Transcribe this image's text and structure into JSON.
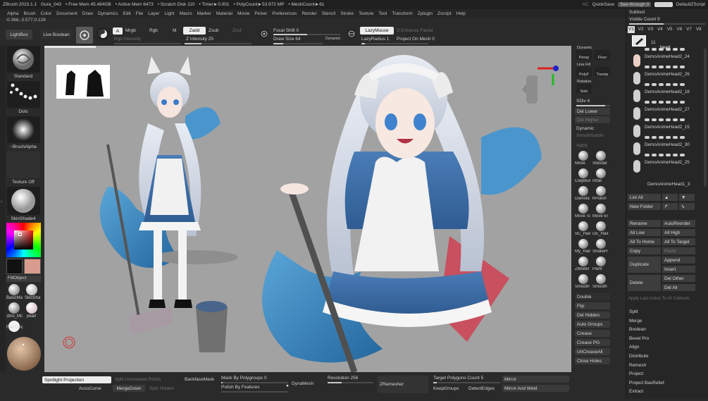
{
  "titlebar": {
    "app": "ZBrush 2023.1.1",
    "document": "Gura_043",
    "free_mem": "• Free Mem 45.484GB",
    "active_mem": "• Active Mem 6473",
    "scratch_disk": "• Scratch Disk 110",
    "timer": "• Timer►0.001",
    "poly_count": "• PolyCount►53.972 MP",
    "mesh_count": "• MeshCount►61",
    "ac": "AC",
    "quicksave": "QuickSave",
    "see_through": "See-through  0",
    "menus": "Menus",
    "default_script": "DefaultZScript"
  },
  "menubar": [
    "Alpha",
    "Brush",
    "Color",
    "Document",
    "Draw",
    "Dynamics",
    "Edit",
    "File",
    "Layer",
    "Light",
    "Macro",
    "Marker",
    "Material",
    "Movie",
    "Picker",
    "Preferences",
    "Render",
    "Stencil",
    "Stroke",
    "Texture",
    "Tool",
    "Transform",
    "Zplugin",
    "Zscript",
    "Help"
  ],
  "coords": "-0.366,-3.577,0.128",
  "topshelf": {
    "lightbox": "LightBox",
    "live_boolean": "Live Boolean",
    "a_btn": "A",
    "mrgb": "Mrgb",
    "rgb": "Rgb",
    "m": "M",
    "zadd": "Zadd",
    "zsub": "Zsub",
    "zcut": "Zcut",
    "rgb_intensity": "Rgb Intensity",
    "z_intensity": "Z Intensity 25",
    "focal_shift": "Focal Shift 0",
    "draw_size": "Draw Size 64",
    "dynamic": "Dynamic",
    "lazymouse": "LazyMouse",
    "lazyradius": "LazyRadius 1",
    "enhance_factor": "S Enhance Factor",
    "project_on_mesh": "Project On Mesh 0"
  },
  "leftpanel": {
    "standard": "Standard",
    "dots": "Dots",
    "brush_alpha": "~BrushAlpha",
    "texture_off": "Texture Off",
    "skin_shade": "SkinShade4",
    "fill_object": "FillObject",
    "mat1": "BasicMa",
    "mat2": "SkinSha",
    "mat3": "zbro_Mc",
    "mat4": "pearl",
    "mat5": "Flat Colc"
  },
  "rightshelf": {
    "dynamic_persp": "Dynamic",
    "persp": "Persp",
    "floor": "Floor",
    "line_fill": "Line Fill",
    "polyf": "PolyF",
    "transp": "Transp",
    "rotation": "Rotation",
    "solo": "Solo",
    "sdiv": "SDiv 4",
    "del_lower": "Del Lower",
    "del_higher": "Del Higher",
    "dynamic2": "Dynamic",
    "smooth_subdiv": "SmoothSubdiv",
    "apply": "Apply",
    "brushes": [
      [
        "Move",
        "Standar"
      ],
      [
        "ClayBuil",
        "Inflat"
      ],
      [
        "Damsta",
        "hPolish"
      ],
      [
        "Move Tc",
        "Move El"
      ],
      [
        "SC_Hair",
        "DE_Hair"
      ],
      [
        "My_Hair",
        "SnakeH"
      ],
      [
        "ZModel",
        "Paint"
      ],
      [
        "Smooth",
        "Smooth"
      ]
    ],
    "double": "Double",
    "flip": "Flip",
    "del_hidden": "Del Hidden",
    "auto_groups": "Auto Groups",
    "crease": "Crease",
    "crease_pg": "Crease PG",
    "uncrease_all": "UnCreaseAll",
    "close_holes": "Close Holes"
  },
  "subtool": {
    "title": "Subtool",
    "visible_count": "Visible Count 9",
    "versions": [
      "V1",
      "V2",
      "V3",
      "V4",
      "V5",
      "V6",
      "V7",
      "V8"
    ],
    "count": "11",
    "head": "head",
    "items": [
      "DemoAnimeHead2_24",
      "DemoAnimeHead2_26",
      "DemoAnimeHead2_18",
      "DemoAnimeHead2_27",
      "DemoAnimeHead2_15",
      "DemoAnimeHead2_30",
      "DemoAnimeHead2_25",
      "DemoAnimeHead1_3"
    ],
    "list_all": "List All",
    "new_folder": "New Folder",
    "rename": "Rename",
    "auto_reorder": "AutoReorder",
    "all_low": "All Low",
    "all_high": "All High",
    "all_to_home": "All To Home",
    "all_to_target": "All To Target",
    "copy": "Copy",
    "paste": "Paste",
    "duplicate": "Duplicate",
    "append": "Append",
    "insert": "Insert",
    "delete": "Delete",
    "del_other": "Del Other",
    "del_all": "Del All",
    "apply_last": "Apply Last Action To All Subtools",
    "actions": [
      "Split",
      "Merge",
      "Boolean",
      "Bevel Pro",
      "Align",
      "Distribute",
      "Remesh",
      "Project",
      "Project BasRelief",
      "Extract"
    ]
  },
  "bottom": {
    "spotlight": "Spotlight Projection",
    "split_unmasked": "Split Unmasked Points",
    "backface_mask": "BackfaceMask",
    "mask_by_polygroups": "Mask By Polygroups 0",
    "dynamesh": "DynaMesh",
    "resolution": "Resolution 256",
    "zremesher": "ZRemesher",
    "target_polygons": "Target Polygons Count 5",
    "mirror": "Mirror",
    "accucurve": "AccuCurve",
    "mergedown": "MergeDown",
    "split_hidden": "Split Hidden",
    "polish_by_features": "Polish By Features",
    "keepgroups": "KeepGroups",
    "detect_edges": "DetectEdges",
    "mirror_and_weld": "Mirror And Weld"
  },
  "colors": {
    "viewport_bg": "#a2a2a2",
    "hair": "#d9dde8",
    "dress_blue": "#3f6ea6",
    "apron": "#f3f3f3",
    "fish_tail": "#3f8fc8",
    "primary_color": "#111111",
    "secondary_color": "#d79c8e"
  }
}
